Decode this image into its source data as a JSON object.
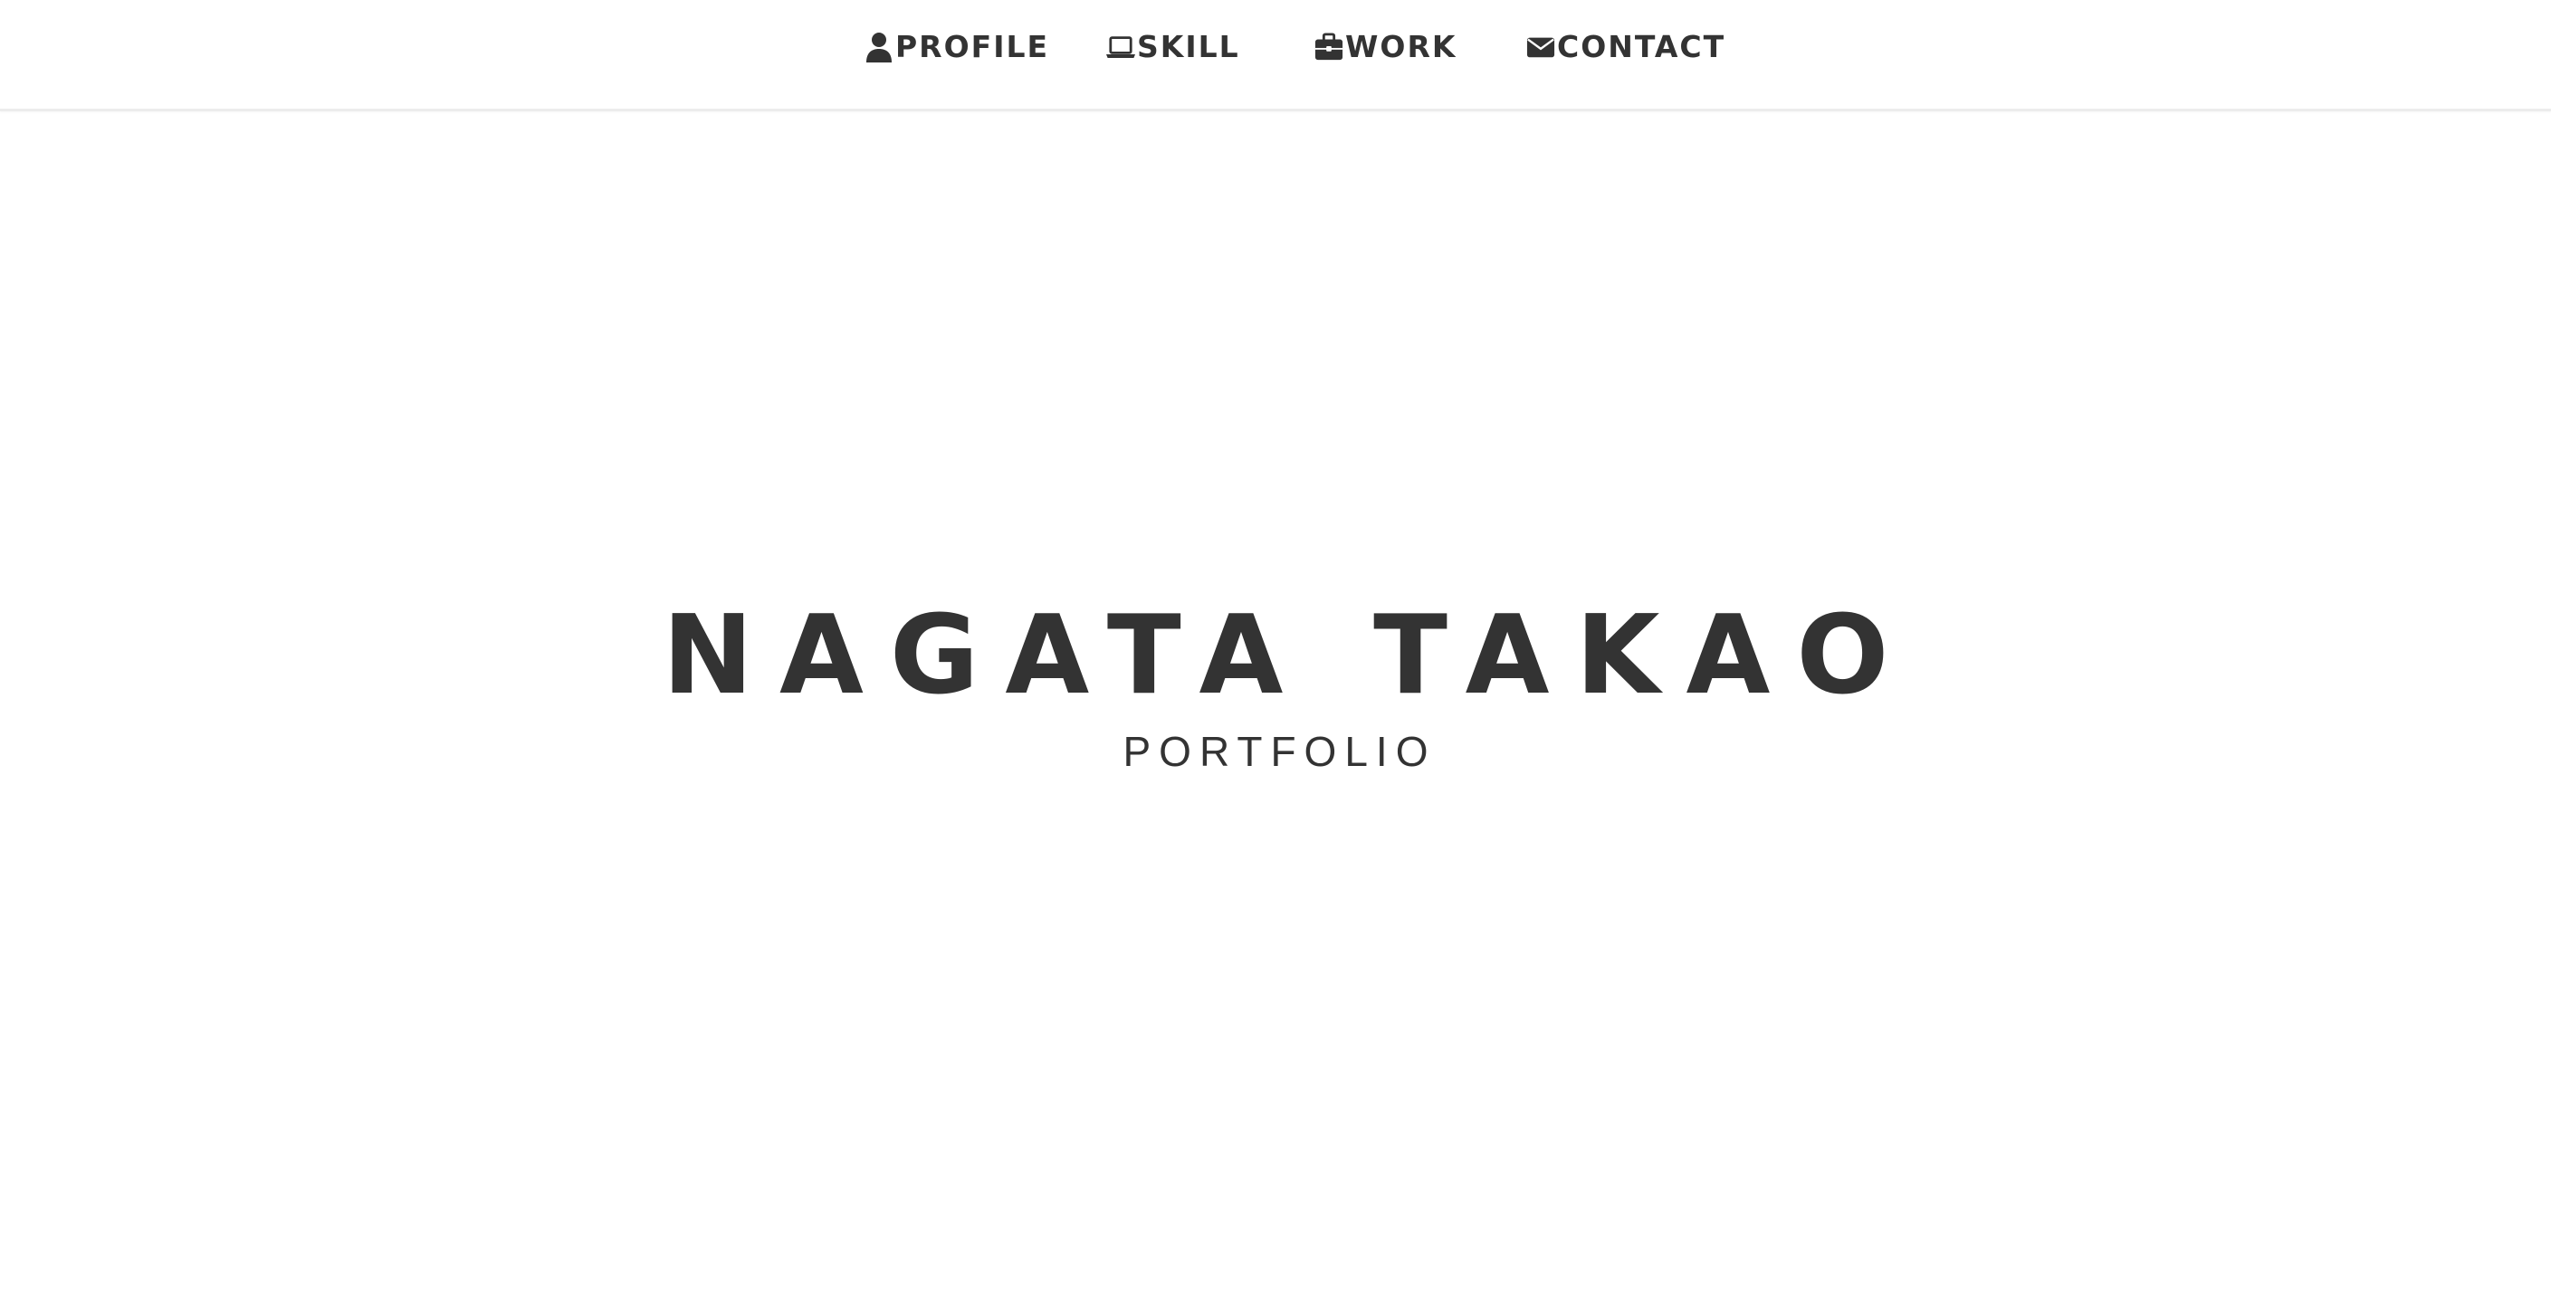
{
  "nav": {
    "items": [
      {
        "label": "PROFILE",
        "icon": "user-icon"
      },
      {
        "label": "SKILL",
        "icon": "laptop-icon"
      },
      {
        "label": "WORK",
        "icon": "briefcase-icon"
      },
      {
        "label": "CONTACT",
        "icon": "envelope-icon"
      }
    ]
  },
  "hero": {
    "title": "NAGATA TAKAO",
    "subtitle": "PORTFOLIO"
  },
  "colors": {
    "text": "#333333",
    "background": "#ffffff",
    "nav_border": "#ececec"
  }
}
